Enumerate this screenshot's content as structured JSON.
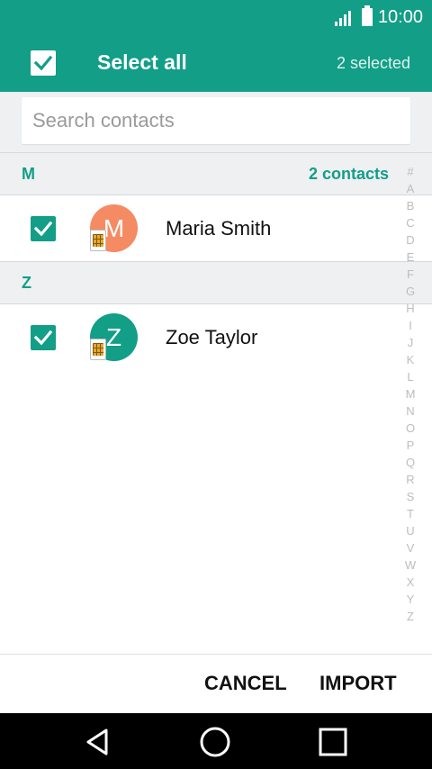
{
  "status_bar": {
    "time": "10:00",
    "signal_icon": "signal-icon",
    "battery_icon": "battery-icon"
  },
  "app_bar": {
    "title": "Select all",
    "selected_count": "2 selected",
    "select_all_checked": true
  },
  "search": {
    "placeholder": "Search contacts",
    "value": ""
  },
  "sections": [
    {
      "letter": "M",
      "count_label": "2 contacts",
      "contacts": [
        {
          "name": "Maria Smith",
          "initial": "M",
          "avatar_color": "#f58b63",
          "checked": true,
          "sim_icon": "sim-card-icon"
        }
      ]
    },
    {
      "letter": "Z",
      "count_label": "",
      "contacts": [
        {
          "name": "Zoe Taylor",
          "initial": "Z",
          "avatar_color": "#129e87",
          "checked": true,
          "sim_icon": "sim-card-icon"
        }
      ]
    }
  ],
  "alpha_index": [
    "#",
    "A",
    "B",
    "C",
    "D",
    "E",
    "F",
    "G",
    "H",
    "I",
    "J",
    "K",
    "L",
    "M",
    "N",
    "O",
    "P",
    "Q",
    "R",
    "S",
    "T",
    "U",
    "V",
    "W",
    "X",
    "Y",
    "Z"
  ],
  "actions": {
    "cancel": "CANCEL",
    "import": "IMPORT"
  },
  "nav": {
    "back_icon": "back-icon",
    "home_icon": "home-icon",
    "recents_icon": "recents-icon"
  },
  "colors": {
    "accent": "#129e87",
    "header_bg": "#eef0f2",
    "avatar_m": "#f58b63"
  }
}
